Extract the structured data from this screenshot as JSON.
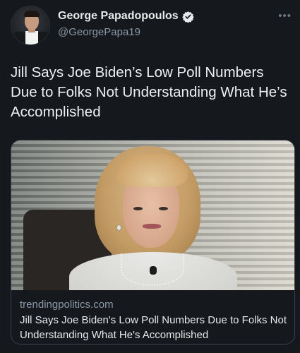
{
  "author": {
    "name": "George Papadopoulos",
    "handle": "@GeorgePapa19",
    "verified": true,
    "avatar_icon": "profile-photo"
  },
  "more_icon": "ellipsis-icon",
  "tweet": {
    "text": "Jill Says Joe Biden’s Low Poll Numbers Due to Folks Not Understanding What He’s Accomplished"
  },
  "card": {
    "domain": "trendingpolitics.com",
    "title": "Jill Says Joe Biden's Low Poll Numbers Due to Folks Not Understanding What He's Accomplished"
  },
  "colors": {
    "background": "#15181c",
    "text": "#e7e9ea",
    "secondary_text": "#8b98a5",
    "card_border": "#3b4147"
  }
}
